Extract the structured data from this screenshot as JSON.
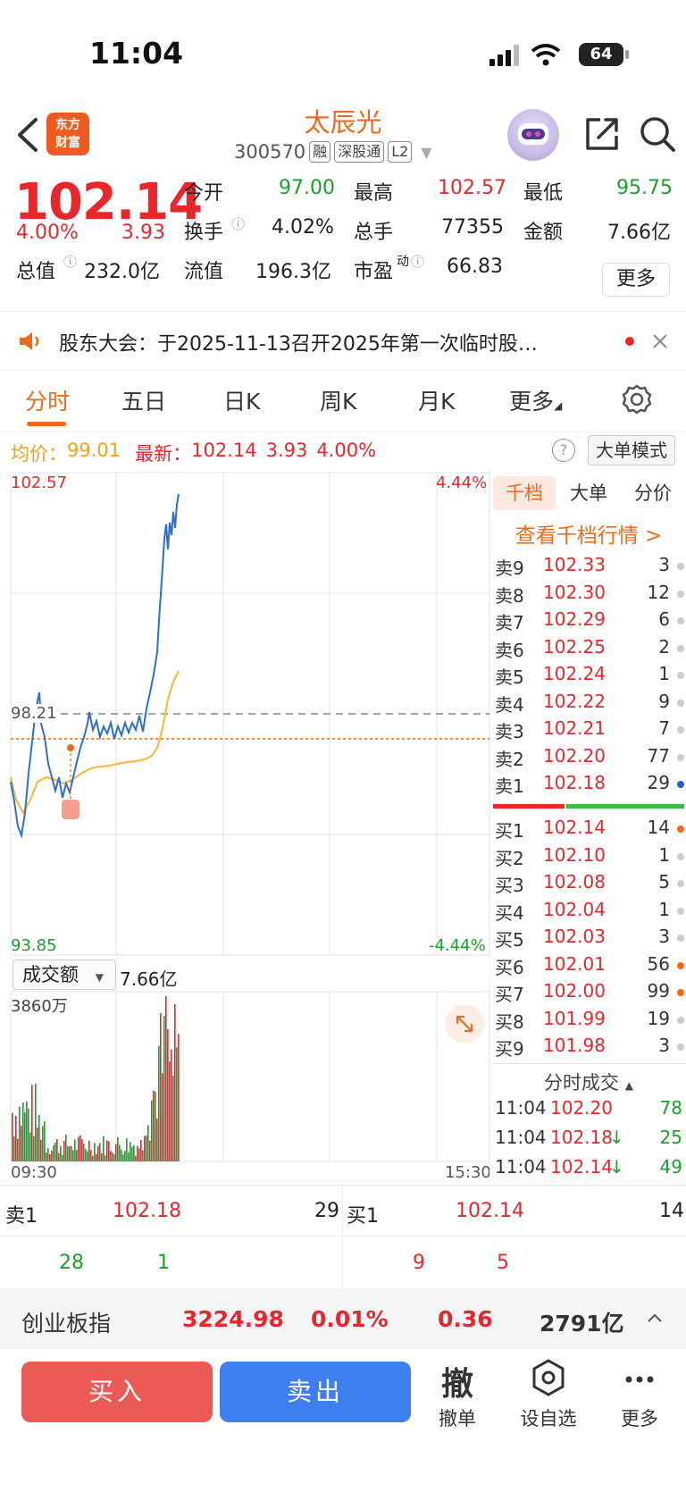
{
  "status": {
    "time": "11:04",
    "battery": "64"
  },
  "header": {
    "logo": "东方\n财富",
    "name": "太辰光",
    "code": "300570",
    "tags": [
      "融",
      "深股通",
      "L2"
    ]
  },
  "quote": {
    "price": "102.14",
    "change_pct": "4.00%",
    "change": "3.93",
    "open_label": "今开",
    "open": "97.00",
    "high_label": "最高",
    "high": "102.57",
    "low_label": "最低",
    "low": "95.75",
    "turnover_label": "换手",
    "turnover": "4.02%",
    "volume_label": "总手",
    "volume": "77355",
    "amount_label": "金额",
    "amount": "7.66亿",
    "mktcap_label": "总值",
    "mktcap": "232.0亿",
    "float_label": "流值",
    "float": "196.3亿",
    "pe_label": "市盈",
    "pe_sup": "动",
    "pe": "66.83",
    "more": "更多"
  },
  "announcement": "股东大会：于2025-11-13召开2025年第一次临时股…",
  "tabs": [
    "分时",
    "五日",
    "日K",
    "周K",
    "月K",
    "更多"
  ],
  "info": {
    "avg_label": "均价：",
    "avg": "99.01",
    "latest_label": "最新：",
    "latest": "102.14",
    "chg": "3.93",
    "pct": "4.00%",
    "big_order": "大单模式"
  },
  "chart": {
    "y_top": "102.57",
    "y_mid": "98.21",
    "y_bottom": "93.85",
    "pct_top": "4.44%",
    "pct_bottom": "-4.44%",
    "marker": "B",
    "time_start": "09:30",
    "time_end": "15:30"
  },
  "volume": {
    "selector": "成交额",
    "amount": "7.66亿",
    "max": "3860万"
  },
  "orderbook": {
    "tabs": [
      "千档",
      "大单",
      "分价"
    ],
    "link": "查看千档行情 >",
    "asks": [
      {
        "label": "卖9",
        "price": "102.33",
        "vol": "3",
        "dot": "#cccccc"
      },
      {
        "label": "卖8",
        "price": "102.30",
        "vol": "12",
        "dot": "#cccccc"
      },
      {
        "label": "卖7",
        "price": "102.29",
        "vol": "6",
        "dot": "#cccccc"
      },
      {
        "label": "卖6",
        "price": "102.25",
        "vol": "2",
        "dot": "#cccccc"
      },
      {
        "label": "卖5",
        "price": "102.24",
        "vol": "1",
        "dot": "#cccccc"
      },
      {
        "label": "卖4",
        "price": "102.22",
        "vol": "9",
        "dot": "#cccccc"
      },
      {
        "label": "卖3",
        "price": "102.21",
        "vol": "7",
        "dot": "#cccccc"
      },
      {
        "label": "卖2",
        "price": "102.20",
        "vol": "77",
        "dot": "#cccccc"
      },
      {
        "label": "卖1",
        "price": "102.18",
        "vol": "29",
        "dot": "#2a5bd7"
      }
    ],
    "bids": [
      {
        "label": "买1",
        "price": "102.14",
        "vol": "14",
        "dot": "#f06a1d"
      },
      {
        "label": "买2",
        "price": "102.10",
        "vol": "1",
        "dot": "#cccccc"
      },
      {
        "label": "买3",
        "price": "102.08",
        "vol": "5",
        "dot": "#cccccc"
      },
      {
        "label": "买4",
        "price": "102.04",
        "vol": "1",
        "dot": "#cccccc"
      },
      {
        "label": "买5",
        "price": "102.03",
        "vol": "3",
        "dot": "#cccccc"
      },
      {
        "label": "买6",
        "price": "102.01",
        "vol": "56",
        "dot": "#f06a1d"
      },
      {
        "label": "买7",
        "price": "102.00",
        "vol": "99",
        "dot": "#f06a1d"
      },
      {
        "label": "买8",
        "price": "101.99",
        "vol": "19",
        "dot": "#cccccc"
      },
      {
        "label": "买9",
        "price": "101.98",
        "vol": "3",
        "dot": "#cccccc"
      }
    ],
    "tick_header": "分时成交",
    "ticks": [
      {
        "time": "11:04",
        "price": "102.20",
        "arrow": "",
        "vol": "78"
      },
      {
        "time": "11:04",
        "price": "102.18",
        "arrow": "↓",
        "vol": "25"
      },
      {
        "time": "11:04",
        "price": "102.14",
        "arrow": "↓",
        "vol": "49"
      }
    ]
  },
  "level1": {
    "sell_label": "卖1",
    "sell_price": "102.18",
    "sell_vol": "29",
    "buy_label": "买1",
    "buy_price": "102.14",
    "buy_vol": "14",
    "sell_sub1": "28",
    "sell_sub2": "1",
    "buy_sub1": "9",
    "buy_sub2": "5"
  },
  "index_bar": {
    "name": "创业板指",
    "value": "3224.98",
    "pct": "0.01%",
    "chg": "0.36",
    "amount": "2791亿"
  },
  "actions": {
    "buy": "买入",
    "sell": "卖出",
    "cancel_icon": "撤",
    "cancel": "撤单",
    "watch": "设自选",
    "more": "更多"
  },
  "colors": {
    "up": "#e8262c",
    "down": "#19a22b",
    "accent": "#f06a1d",
    "price_line": "#2e6fd0",
    "avg_line": "#f7b733"
  }
}
